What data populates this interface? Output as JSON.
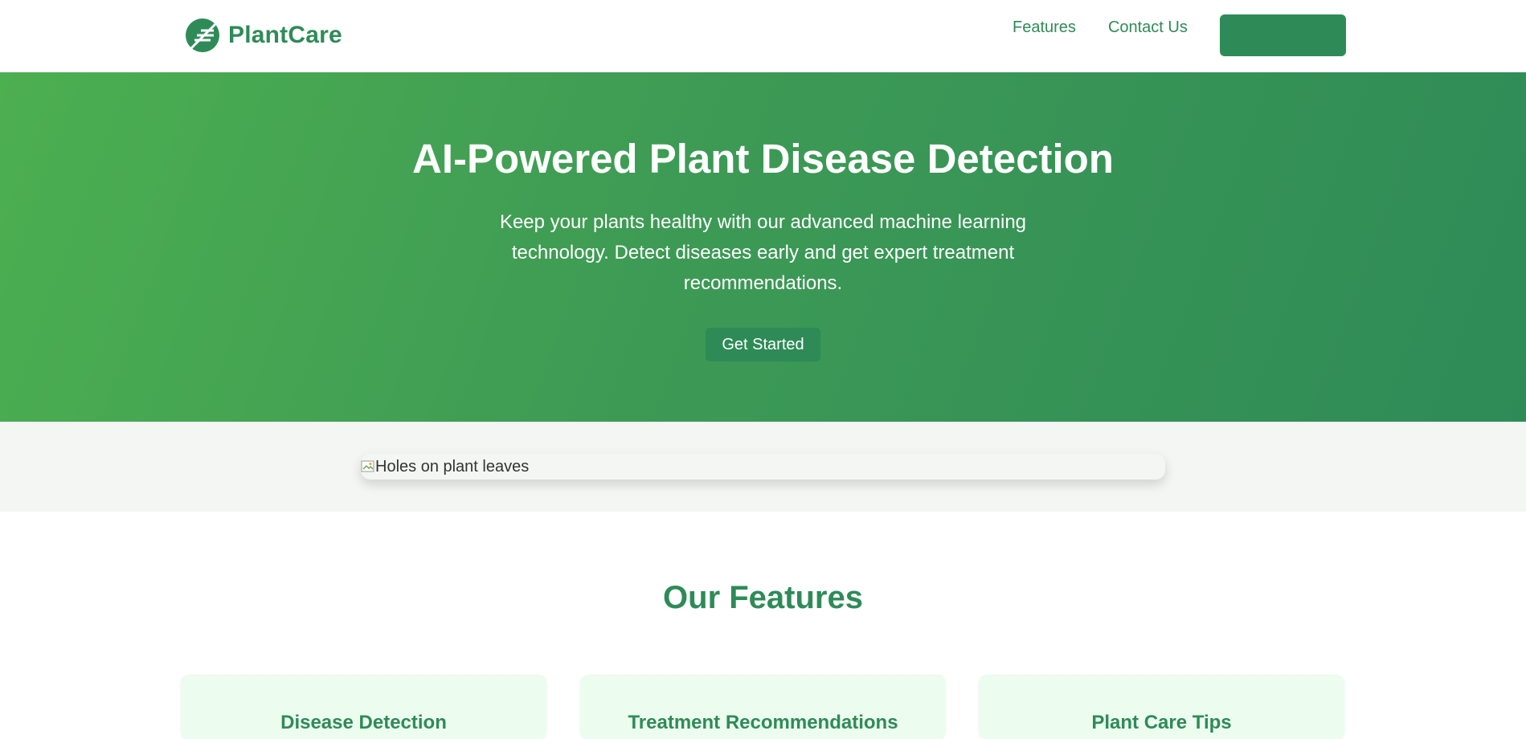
{
  "brand": {
    "name": "PlantCare",
    "logo_icon": "leaf-icon",
    "color": "#2e8b57"
  },
  "nav": {
    "items": [
      {
        "label": "Features"
      },
      {
        "label": "Contact Us"
      }
    ],
    "cta_label": ""
  },
  "hero": {
    "title": "AI-Powered Plant Disease Detection",
    "subtitle": "Keep your plants healthy with our advanced machine learning technology. Detect diseases early and get expert treatment recommendations.",
    "button_label": "Get Started",
    "gradient_start": "#4caf50",
    "gradient_end": "#2e8b57"
  },
  "showcase": {
    "image_alt": "Holes on plant leaves",
    "image_icon": "broken-image-icon"
  },
  "features": {
    "title": "Our Features",
    "cards": [
      {
        "title": "Disease Detection"
      },
      {
        "title": "Treatment Recommendations"
      },
      {
        "title": "Plant Care Tips"
      }
    ],
    "card_background": "#ecfcef"
  }
}
